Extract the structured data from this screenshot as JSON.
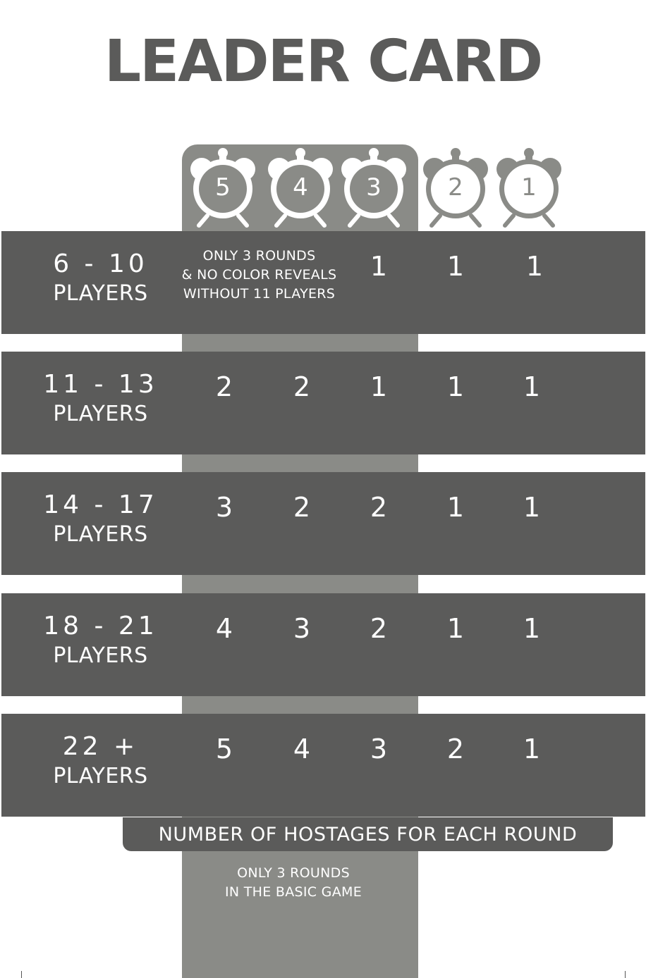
{
  "title": "LEADER CARD",
  "clocks": [
    {
      "label": "5",
      "style": "filled"
    },
    {
      "label": "4",
      "style": "filled"
    },
    {
      "label": "3",
      "style": "filled"
    },
    {
      "label": "2",
      "style": "outline"
    },
    {
      "label": "1",
      "style": "outline"
    }
  ],
  "rows": [
    {
      "range": "6 - 10",
      "players": "PLAYERS",
      "note": [
        "ONLY 3 ROUNDS",
        "& NO COLOR REVEALS",
        "WITHOUT 11 PLAYERS"
      ],
      "values": [
        "",
        "",
        "1",
        "1",
        "1"
      ]
    },
    {
      "range": "11 - 13",
      "players": "PLAYERS",
      "values": [
        "2",
        "2",
        "1",
        "1",
        "1"
      ]
    },
    {
      "range": "14 - 17",
      "players": "PLAYERS",
      "values": [
        "3",
        "2",
        "2",
        "1",
        "1"
      ]
    },
    {
      "range": "18 - 21",
      "players": "PLAYERS",
      "values": [
        "4",
        "3",
        "2",
        "1",
        "1"
      ]
    },
    {
      "range": "22 +",
      "players": "PLAYERS",
      "values": [
        "5",
        "4",
        "3",
        "2",
        "1"
      ]
    }
  ],
  "footer": "NUMBER OF HOSTAGES FOR EACH ROUND",
  "basic_note": [
    "ONLY 3 ROUNDS",
    "IN THE BASIC GAME"
  ],
  "colors": {
    "dark": "#5b5b5a",
    "light_column": "#8a8b87",
    "background": "#ffffff",
    "text": "#ffffff"
  }
}
